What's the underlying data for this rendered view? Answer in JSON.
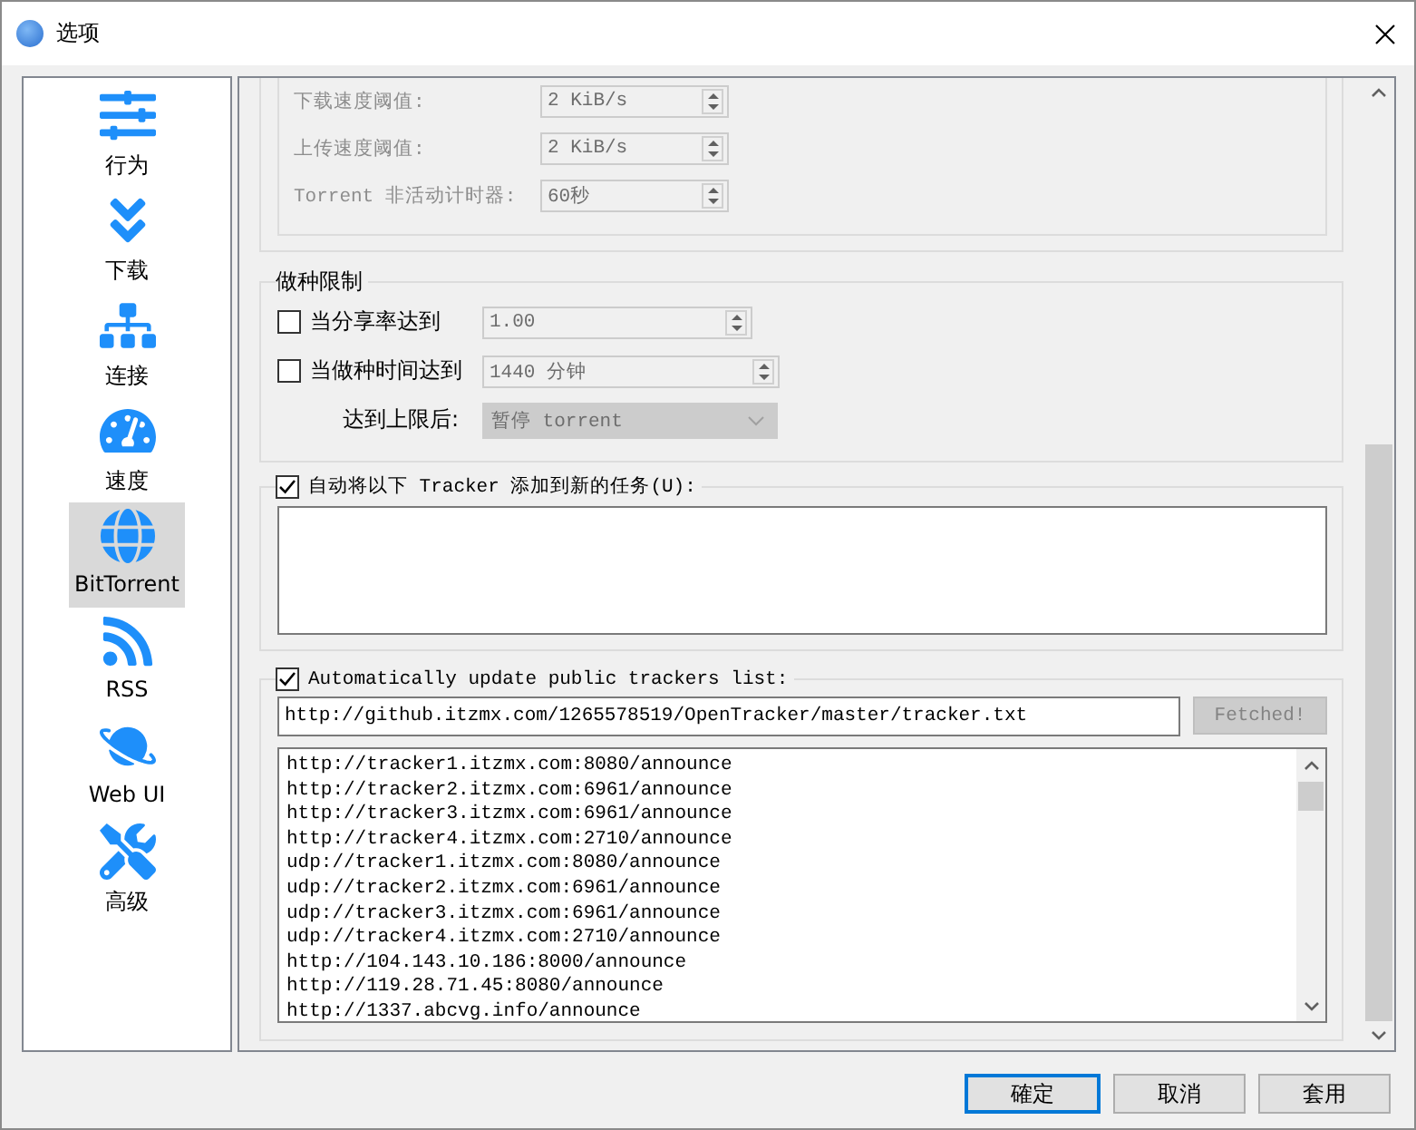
{
  "window": {
    "title": "选项"
  },
  "sidebar": {
    "items": [
      {
        "label": "行为",
        "selected": false
      },
      {
        "label": "下载",
        "selected": false
      },
      {
        "label": "连接",
        "selected": false
      },
      {
        "label": "速度",
        "selected": false
      },
      {
        "label": "BitTorrent",
        "selected": true
      },
      {
        "label": "RSS",
        "selected": false
      },
      {
        "label": "Web UI",
        "selected": false
      },
      {
        "label": "高级",
        "selected": false
      }
    ]
  },
  "speed_thresholds": {
    "rows": [
      {
        "label": "下载速度阈值:",
        "value": "2 KiB/s",
        "disabled": true
      },
      {
        "label": "上传速度阈值:",
        "value": "2 KiB/s",
        "disabled": true
      },
      {
        "label": "Torrent 非活动计时器:",
        "value": "60秒",
        "disabled": true
      }
    ]
  },
  "seeding_limits": {
    "title": "做种限制",
    "rows": [
      {
        "kind": "checkbox",
        "label": "当分享率达到",
        "checked": false,
        "value": "1.00"
      },
      {
        "kind": "checkbox",
        "label": "当做种时间达到",
        "checked": false,
        "value": "1440 分钟"
      },
      {
        "kind": "select",
        "label": "达到上限后:",
        "disabled": true,
        "value": "暂停 torrent"
      }
    ]
  },
  "auto_add_trackers": {
    "label": "自动将以下 Tracker 添加到新的任务(U):",
    "checked": true
  },
  "auto_update": {
    "label": "Automatically update public trackers list:",
    "checked": true,
    "url": "http://github.itzmx.com/1265578519/OpenTracker/master/tracker.txt",
    "button": "Fetched!",
    "button_disabled": true,
    "trackers": [
      "http://tracker1.itzmx.com:8080/announce",
      "http://tracker2.itzmx.com:6961/announce",
      "http://tracker3.itzmx.com:6961/announce",
      "http://tracker4.itzmx.com:2710/announce",
      "udp://tracker1.itzmx.com:8080/announce",
      "udp://tracker2.itzmx.com:6961/announce",
      "udp://tracker3.itzmx.com:6961/announce",
      "udp://tracker4.itzmx.com:2710/announce",
      "http://104.143.10.186:8000/announce",
      "http://119.28.71.45:8080/announce",
      "http://1337.abcvg.info/announce"
    ]
  },
  "buttons": [
    {
      "label": "確定",
      "default": true
    },
    {
      "label": "取消",
      "default": false
    },
    {
      "label": "套用",
      "default": false
    }
  ]
}
